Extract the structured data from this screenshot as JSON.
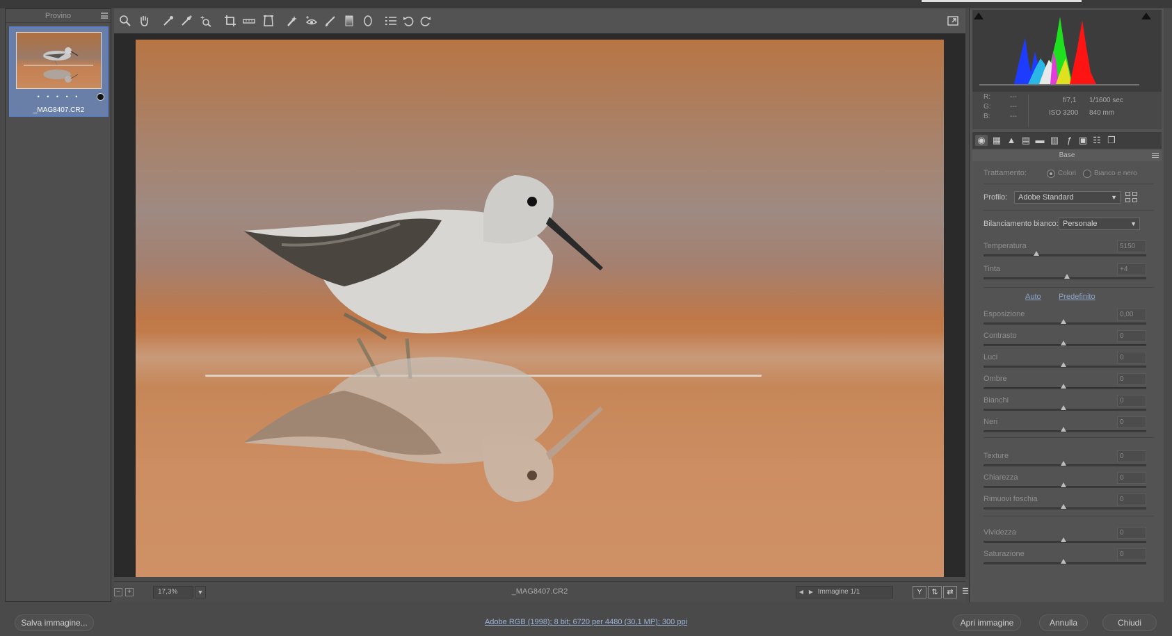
{
  "filmstrip": {
    "title": "Provino",
    "thumbnail": {
      "filename": "_MAG8407.CR2",
      "rating_dots": "• • • • •"
    }
  },
  "toolbar": {
    "tools": [
      "zoom-icon",
      "hand-icon",
      "white-balance-icon",
      "color-sampler-icon",
      "targeted-adjustment-icon",
      "crop-icon",
      "straighten-icon",
      "transform-icon",
      "spot-removal-icon",
      "red-eye-icon",
      "adjustment-brush-icon",
      "graduated-filter-icon",
      "radial-filter-icon",
      "preferences-icon",
      "rotate-left-icon",
      "rotate-right-icon"
    ]
  },
  "status": {
    "zoom_value": "17,3%",
    "filename": "_MAG8407.CR2",
    "image_counter": "Immagine 1/1",
    "before_after_label": "Y"
  },
  "camera_info": {
    "r_label": "R:",
    "g_label": "G:",
    "b_label": "B:",
    "r_value": "---",
    "g_value": "---",
    "b_value": "---",
    "aperture": "f/7,1",
    "shutter": "1/1600 sec",
    "iso": "ISO 3200",
    "focal": "840 mm"
  },
  "panel": {
    "section_title": "Base",
    "treatment_label": "Trattamento:",
    "treatment_color": "Colori",
    "treatment_bw": "Bianco e nero",
    "profile_label": "Profilo:",
    "profile_value": "Adobe Standard",
    "wb_label": "Bilanciamento bianco:",
    "wb_value": "Personale",
    "auto_label": "Auto",
    "default_label": "Predefinito",
    "sliders": [
      {
        "label": "Temperatura",
        "value": "5150"
      },
      {
        "label": "Tinta",
        "value": "+4"
      },
      {
        "label": "Esposizione",
        "value": "0,00"
      },
      {
        "label": "Contrasto",
        "value": "0"
      },
      {
        "label": "Luci",
        "value": "0"
      },
      {
        "label": "Ombre",
        "value": "0"
      },
      {
        "label": "Bianchi",
        "value": "0"
      },
      {
        "label": "Neri",
        "value": "0"
      },
      {
        "label": "Texture",
        "value": "0"
      },
      {
        "label": "Chiarezza",
        "value": "0"
      },
      {
        "label": "Rimuovi foschia",
        "value": "0"
      },
      {
        "label": "Vividezza",
        "value": "0"
      },
      {
        "label": "Saturazione",
        "value": "0"
      }
    ]
  },
  "bottom": {
    "save_label": "Salva immagine...",
    "workflow_info": "Adobe RGB (1998); 8 bit; 6720 per 4480 (30,1 MP); 300 ppi",
    "open_label": "Apri immagine",
    "cancel_label": "Annulla",
    "close_label": "Chiudi"
  },
  "colors": {
    "accent_selection": "#5e7fc8",
    "link": "#8fa6c8"
  }
}
